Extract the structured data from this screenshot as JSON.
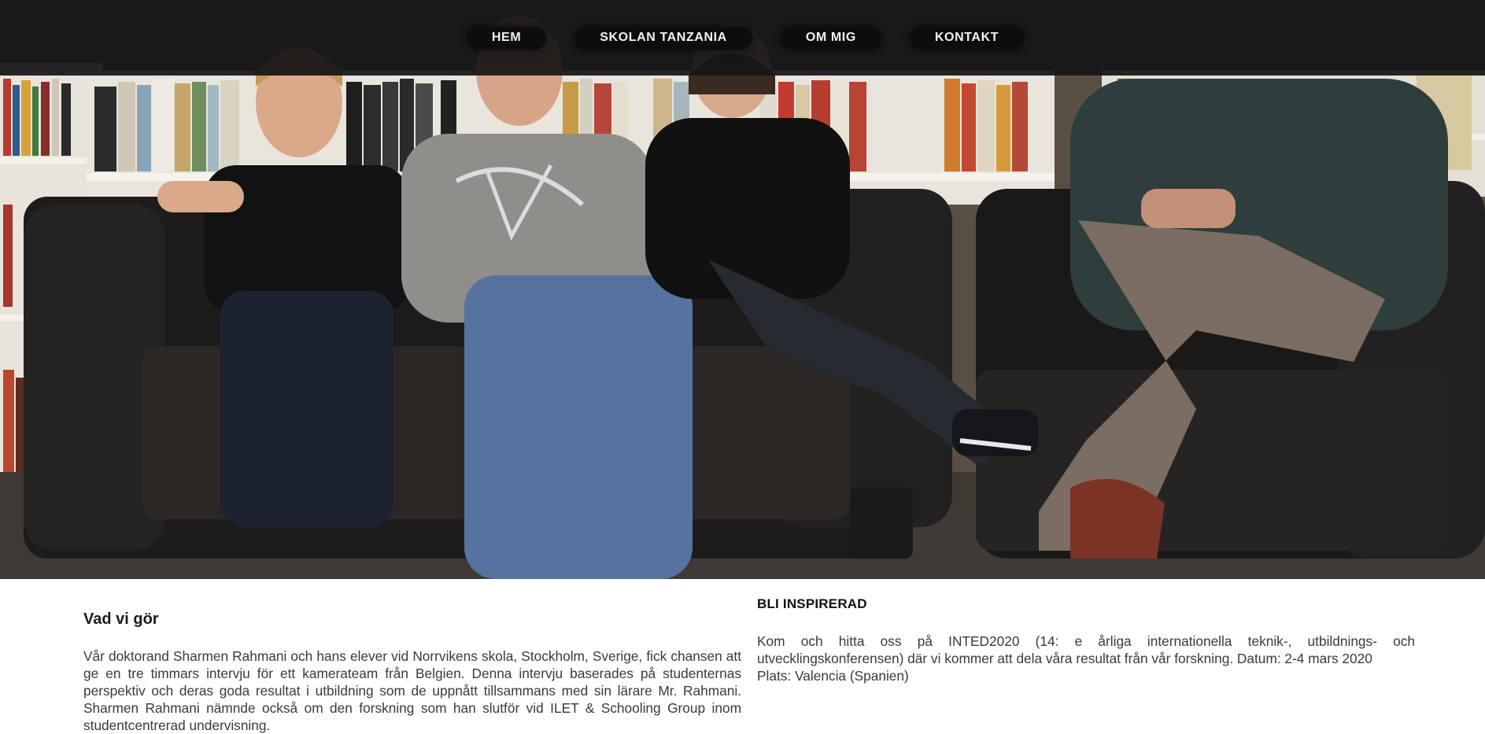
{
  "nav": {
    "items": [
      {
        "label": "HEM"
      },
      {
        "label": "SKOLAN TANZANIA"
      },
      {
        "label": "OM MIG"
      },
      {
        "label": "KONTAKT"
      }
    ]
  },
  "hero": {
    "image_description": "Fyra personer sitter i svarta läderfåtöljer/soffor framför bokhyllor"
  },
  "left": {
    "heading": "Vad vi gör",
    "text": "Vår doktorand Sharmen Rahmani och hans elever vid Norrvikens skola, Stockholm, Sverige, fick chansen att ge en tre timmars intervju för ett kamerateam från Belgien. Denna intervju baserades på studenternas perspektiv och deras goda resultat i utbildning som de uppnått tillsammans med sin lärare Mr. Rahmani. Sharmen Rahmani nämnde också om den forskning som han slutför vid ILET & Schooling Group inom studentcentrerad undervisning."
  },
  "right": {
    "heading": "BLI INSPIRERAD",
    "text_1": "Kom och hitta oss på INTED2020 (14: e årliga internationella teknik-, utbildnings- och utvecklingskonferensen) där vi kommer att dela våra resultat från vår forskning. Datum: 2-4 mars 2020",
    "text_2": "Plats: Valencia (Spanien)"
  },
  "colors": {
    "nav_bg": "#161616",
    "nav_pill": "#0d0d0d",
    "page_bg": "#ffffff"
  }
}
